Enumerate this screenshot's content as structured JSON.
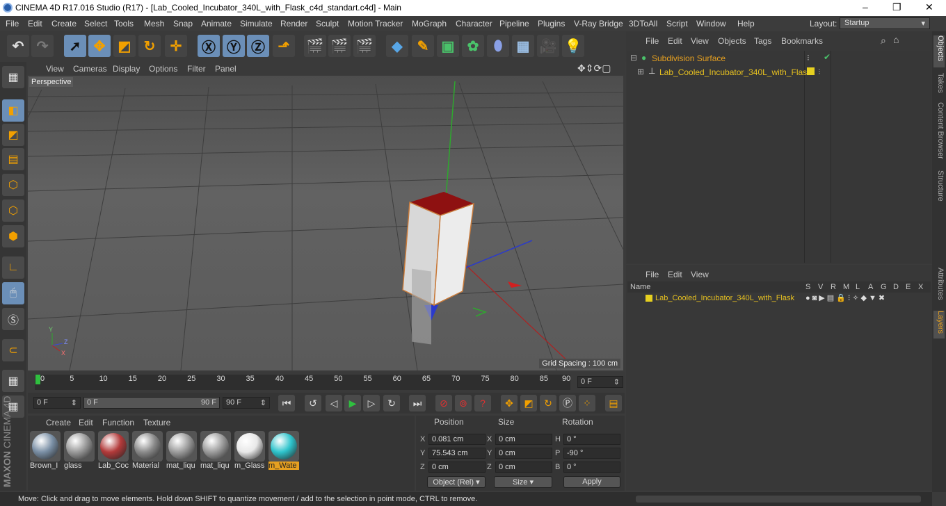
{
  "titlebar": {
    "title": "CINEMA 4D R17.016 Studio (R17) - [Lab_Cooled_Incubator_340L_with_Flask_c4d_standart.c4d] - Main",
    "min": "–",
    "max": "❐",
    "close": "✕"
  },
  "menu": [
    "File",
    "Edit",
    "Create",
    "Select",
    "Tools",
    "Mesh",
    "Snap",
    "Animate",
    "Simulate",
    "Render",
    "Sculpt",
    "Motion Tracker",
    "MoGraph",
    "Character",
    "Pipeline",
    "Plugins",
    "V-Ray Bridge",
    "3DToAll",
    "Script",
    "Window",
    "Help"
  ],
  "layout": {
    "label": "Layout:",
    "value": "Startup"
  },
  "viewport": {
    "menu": [
      "View",
      "Cameras",
      "Display",
      "Options",
      "Filter",
      "Panel"
    ],
    "camera": "Perspective",
    "grid_spacing": "Grid Spacing : 100 cm",
    "axis_x": "X",
    "axis_y": "Y",
    "axis_z": "Z"
  },
  "timeline": {
    "ticks": [
      "0",
      "5",
      "10",
      "15",
      "20",
      "25",
      "30",
      "35",
      "40",
      "45",
      "50",
      "55",
      "60",
      "65",
      "70",
      "75",
      "80",
      "85",
      "90"
    ],
    "current": "0 F",
    "start": "0 F",
    "range_start": "0 F",
    "range_end": "90 F",
    "end": "90 F"
  },
  "materials": {
    "menu": [
      "Create",
      "Edit",
      "Function",
      "Texture"
    ],
    "items": [
      {
        "label": "Brown_I",
        "color": "#7a8fa5"
      },
      {
        "label": "glass",
        "color": "#9a9a9a"
      },
      {
        "label": "Lab_Coc",
        "color": "#b23a3a"
      },
      {
        "label": "Material",
        "color": "#8a8a8a"
      },
      {
        "label": "mat_liqu",
        "color": "#9c9c9c"
      },
      {
        "label": "mat_liqu",
        "color": "#9c9c9c"
      },
      {
        "label": "m_Glass",
        "color": "#e8e8e8"
      },
      {
        "label": "m_Wate",
        "color": "#2ec4cc"
      }
    ]
  },
  "coords": {
    "headers": [
      "Position",
      "Size",
      "Rotation"
    ],
    "rows": [
      {
        "a": "X",
        "pos": "0.081 cm",
        "b": "X",
        "size": "0 cm",
        "c": "H",
        "rot": "0 °"
      },
      {
        "a": "Y",
        "pos": "75.543 cm",
        "b": "Y",
        "size": "0 cm",
        "c": "P",
        "rot": "-90 °"
      },
      {
        "a": "Z",
        "pos": "0 cm",
        "b": "Z",
        "size": "0 cm",
        "c": "B",
        "rot": "0 °"
      }
    ],
    "mode": "Object (Rel)",
    "size_mode": "Size",
    "apply": "Apply"
  },
  "status": "Move: Click and drag to move elements. Hold down SHIFT to quantize movement / add to the selection in point mode, CTRL to remove.",
  "objects": {
    "menu": [
      "File",
      "Edit",
      "View",
      "Objects",
      "Tags",
      "Bookmarks"
    ],
    "items": [
      "Subdivision Surface",
      "Lab_Cooled_Incubator_340L_with_Flask"
    ]
  },
  "layers": {
    "menu": [
      "File",
      "Edit",
      "View"
    ],
    "name_header": "Name",
    "cols": [
      "S",
      "V",
      "R",
      "M",
      "L",
      "A",
      "G",
      "D",
      "E",
      "X"
    ],
    "items": [
      "Lab_Cooled_Incubator_340L_with_Flask"
    ]
  },
  "right_tabs": [
    "Objects",
    "Takes",
    "Content Browser",
    "Structure",
    "Attributes",
    "Layers"
  ],
  "brand": {
    "maxon": "MAXON",
    "product": "CINEMA 4D"
  }
}
